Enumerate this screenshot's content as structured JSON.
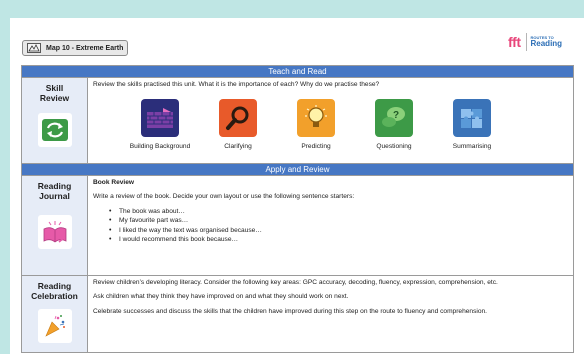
{
  "header": {
    "map_badge": "Map 10 - Extreme Earth",
    "brand_logo": "fft",
    "brand_small": "ROUTES TO",
    "brand_big": "Reading"
  },
  "sections": {
    "teach_and_read": "Teach and Read",
    "apply_and_review": "Apply and Review"
  },
  "skill_review": {
    "title_line1": "Skill",
    "title_line2": "Review",
    "question": "Review the skills practised this unit. What it is the importance of each? Why do we practise these?",
    "skills": [
      {
        "label": "Building Background",
        "icon": "brick-wall-icon",
        "color": "#2b2e7a"
      },
      {
        "label": "Clarifying",
        "icon": "magnifying-glass-icon",
        "color": "#e85a2a"
      },
      {
        "label": "Predicting",
        "icon": "lightbulb-icon",
        "color": "#f2a02b"
      },
      {
        "label": "Questioning",
        "icon": "question-bubble-icon",
        "color": "#3d9a47"
      },
      {
        "label": "Summarising",
        "icon": "puzzle-icon",
        "color": "#3a73b8"
      }
    ]
  },
  "reading_journal": {
    "title_line1": "Reading",
    "title_line2": "Journal",
    "heading": "Book Review",
    "intro": "Write a review of the book. Decide your own layout or use the following sentence starters:",
    "starters": [
      "The book was about…",
      "My favourite part was…",
      "I liked the way the text was organised because…",
      "I would recommend this book because…"
    ]
  },
  "reading_celebration": {
    "title_line1": "Reading",
    "title_line2": "Celebration",
    "p1": "Review children’s developing literacy. Consider the following key areas: GPC accuracy, decoding, fluency, expression, comprehension, etc.",
    "p2": "Ask children what they think they have improved on and what they should work on next.",
    "p3": "Celebrate successes and discuss the skills that the children have improved during this step on the route to fluency and comprehension."
  },
  "colors": {
    "band": "#bfe6e4",
    "section_bar": "#4677c4",
    "left_cell": "#e6ecf7",
    "brand_pink": "#e8457a",
    "brand_blue": "#2a6db5"
  }
}
